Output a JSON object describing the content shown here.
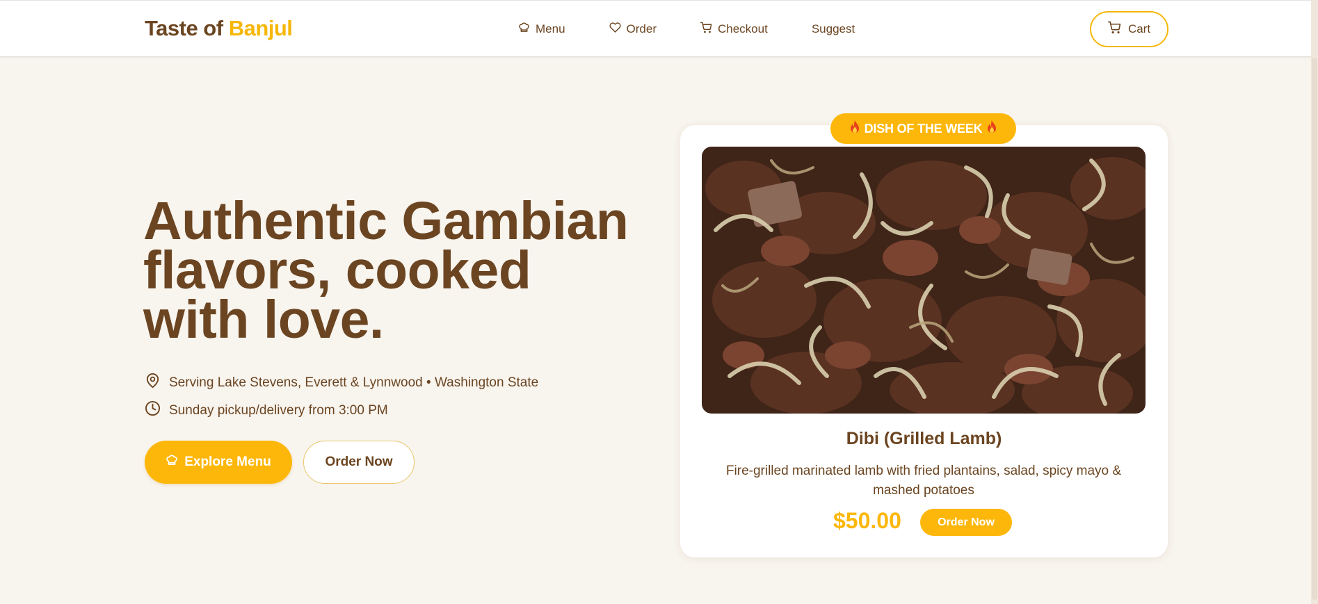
{
  "header": {
    "logo_part1": "Taste of",
    "logo_part2": "Banjul",
    "nav": [
      {
        "label": "Menu",
        "icon": "chef-hat-icon"
      },
      {
        "label": "Order",
        "icon": "heart-icon"
      },
      {
        "label": "Checkout",
        "icon": "cart-icon"
      },
      {
        "label": "Suggest",
        "icon": ""
      }
    ],
    "cart_label": "Cart"
  },
  "hero": {
    "title": "Authentic Gambian flavors, cooked with love.",
    "location": "Serving Lake Stevens, Everett & Lynnwood • Washington State",
    "hours": "Sunday pickup/delivery from 3:00 PM",
    "explore_label": "Explore Menu",
    "order_label": "Order Now"
  },
  "featured": {
    "badge": "DISH OF THE WEEK",
    "name": "Dibi (Grilled Lamb)",
    "description": "Fire-grilled marinated lamb with fried plantains, salad, spicy mayo & mashed potatoes",
    "price": "$50.00",
    "order_label": "Order Now"
  },
  "colors": {
    "brand_brown": "#6b4521",
    "accent_yellow": "#fdb70a",
    "page_bg": "#f8f4ee"
  }
}
